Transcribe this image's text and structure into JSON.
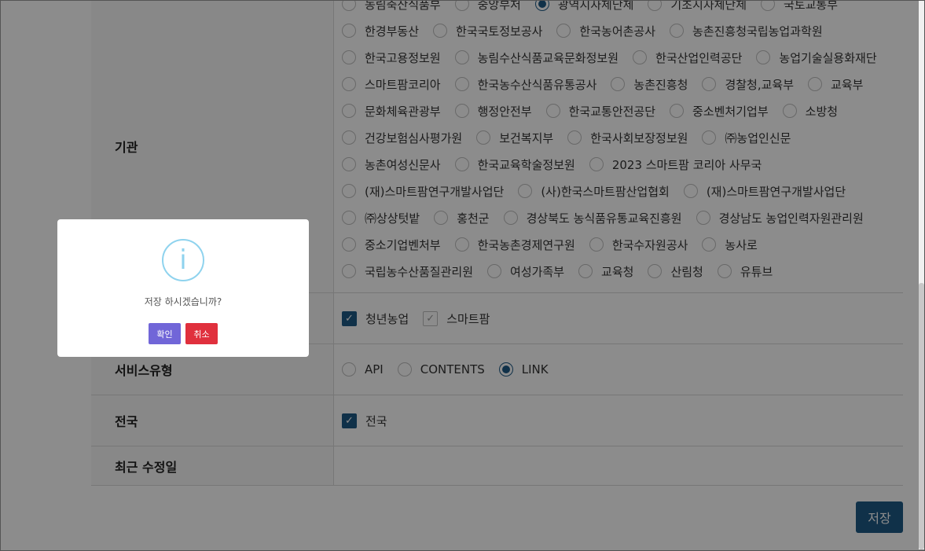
{
  "form": {
    "org_label": "기관",
    "org_options": [
      [
        {
          "label": "농림축산식품부",
          "selected": false
        },
        {
          "label": "중앙부처",
          "selected": false
        },
        {
          "label": "광역지자체단체",
          "selected": true
        },
        {
          "label": "기초지자체단체",
          "selected": false
        },
        {
          "label": "국토교통부",
          "selected": false
        }
      ],
      [
        {
          "label": "한경부동산",
          "selected": false
        },
        {
          "label": "한국국토정보공사",
          "selected": false
        },
        {
          "label": "한국농어촌공사",
          "selected": false
        },
        {
          "label": "농촌진흥청국립농업과학원",
          "selected": false
        }
      ],
      [
        {
          "label": "한국고용정보원",
          "selected": false
        },
        {
          "label": "농림수산식품교육문화정보원",
          "selected": false
        },
        {
          "label": "한국산업인력공단",
          "selected": false
        },
        {
          "label": "농업기술실용화재단",
          "selected": false
        }
      ],
      [
        {
          "label": "스마트팜코리아",
          "selected": false
        },
        {
          "label": "한국농수산식품유통공사",
          "selected": false
        },
        {
          "label": "농촌진흥청",
          "selected": false
        },
        {
          "label": "경찰청,교육부",
          "selected": false
        },
        {
          "label": "교육부",
          "selected": false
        }
      ],
      [
        {
          "label": "문화체육관광부",
          "selected": false
        },
        {
          "label": "행정안전부",
          "selected": false
        },
        {
          "label": "한국교통안전공단",
          "selected": false
        },
        {
          "label": "중소벤처기업부",
          "selected": false
        },
        {
          "label": "소방청",
          "selected": false
        }
      ],
      [
        {
          "label": "건강보험심사평가원",
          "selected": false
        },
        {
          "label": "보건복지부",
          "selected": false
        },
        {
          "label": "한국사회보장정보원",
          "selected": false
        },
        {
          "label": "㈜농업인신문",
          "selected": false
        }
      ],
      [
        {
          "label": "농촌여성신문사",
          "selected": false
        },
        {
          "label": "한국교육학술정보원",
          "selected": false
        },
        {
          "label": "2023 스마트팜 코리아 사무국",
          "selected": false
        }
      ],
      [
        {
          "label": "(재)스마트팜연구개발사업단",
          "selected": false
        },
        {
          "label": "(사)한국스마트팜산업협회",
          "selected": false
        },
        {
          "label": "(재)스마트팜연구개발사업단",
          "selected": false
        }
      ],
      [
        {
          "label": "㈜상상텃밭",
          "selected": false
        },
        {
          "label": "홍천군",
          "selected": false
        },
        {
          "label": "경상북도 농식품유통교육진흥원",
          "selected": false
        },
        {
          "label": "경상남도 농업인력자원관리원",
          "selected": false
        }
      ],
      [
        {
          "label": "중소기업벤처부",
          "selected": false
        },
        {
          "label": "한국농촌경제연구원",
          "selected": false
        },
        {
          "label": "한국수자원공사",
          "selected": false
        },
        {
          "label": "농사로",
          "selected": false
        }
      ],
      [
        {
          "label": "국립농수산품질관리원",
          "selected": false
        },
        {
          "label": "여성가족부",
          "selected": false
        },
        {
          "label": "교육청",
          "selected": false
        },
        {
          "label": "산림청",
          "selected": false
        },
        {
          "label": "유튜브",
          "selected": false
        }
      ]
    ],
    "category_options": [
      {
        "label": "청년농업",
        "checked": true,
        "disabled": false
      },
      {
        "label": "스마트팜",
        "checked": true,
        "disabled": true
      }
    ],
    "service_label": "서비스유형",
    "service_options": [
      {
        "label": "API",
        "selected": false
      },
      {
        "label": "CONTENTS",
        "selected": false
      },
      {
        "label": "LINK",
        "selected": true
      }
    ],
    "national_label": "전국",
    "national_option": {
      "label": "전국",
      "checked": true
    },
    "updated_label": "최근 수정일",
    "save_label": "저장"
  },
  "modal": {
    "icon": "info-icon",
    "message": "저장 하시겠습니까?",
    "confirm_label": "확인",
    "cancel_label": "취소"
  },
  "colors": {
    "primary": "#1e5a86",
    "confirm": "#7166d8",
    "cancel": "#e0303d",
    "info_icon": "#8fd3ee"
  }
}
